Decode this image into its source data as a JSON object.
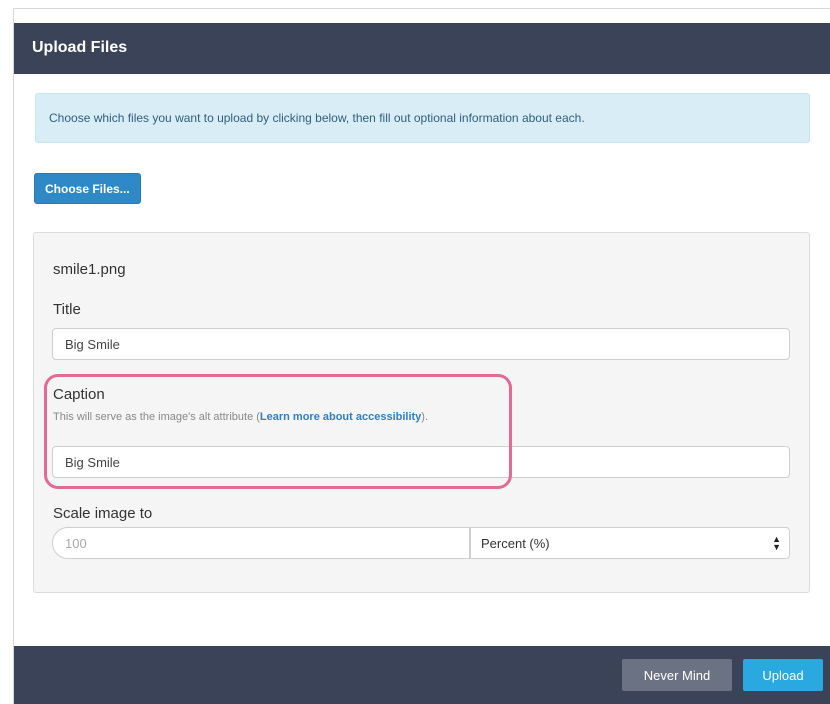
{
  "header": {
    "title": "Upload Files"
  },
  "alert": {
    "text": "Choose which files you want to upload by clicking below, then fill out optional information about each."
  },
  "choose_button": {
    "label": "Choose Files..."
  },
  "file": {
    "name": "smile1.png",
    "title_label": "Title",
    "title_value": "Big Smile",
    "caption_label": "Caption",
    "caption_help_prefix": "This will serve as the image's alt attribute (",
    "caption_help_link": "Learn more about accessibility",
    "caption_help_suffix": ").",
    "caption_value": "Big Smile",
    "scale_label": "Scale image to",
    "scale_placeholder": "100",
    "scale_unit": "Percent (%)"
  },
  "footer": {
    "never_mind_label": "Never Mind",
    "upload_label": "Upload"
  },
  "colors": {
    "header_bg": "#3b4359",
    "primary_button": "#2f89c6",
    "upload_button": "#2aa8e0",
    "highlight": "#e56a92",
    "alert_bg": "#d9edf7"
  },
  "icons": {
    "select_arrows": "sort-arrows-icon"
  }
}
